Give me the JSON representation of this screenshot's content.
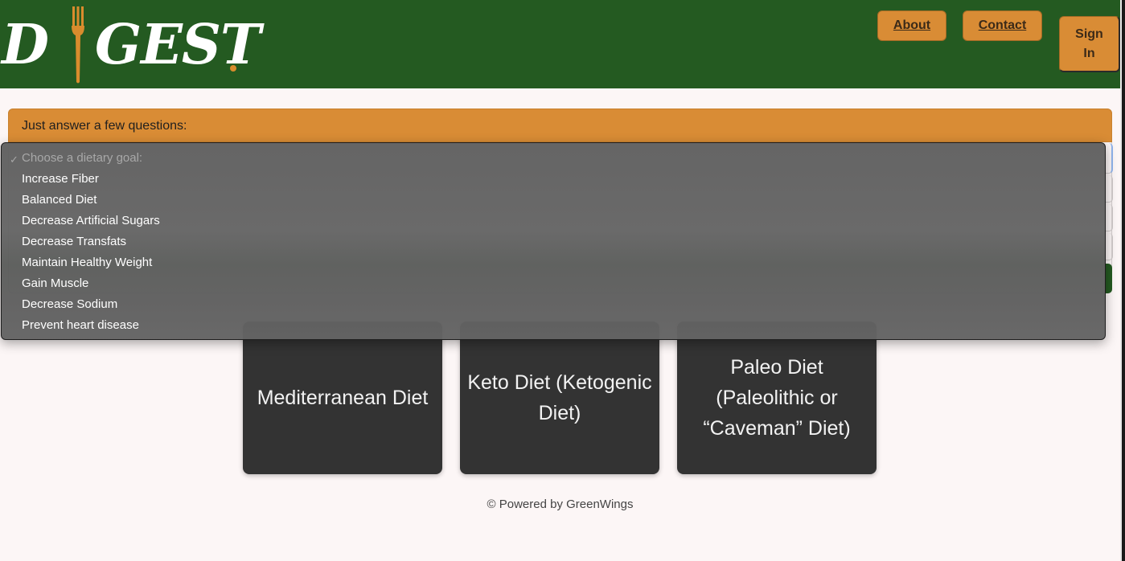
{
  "logo": {
    "letter_d": "D",
    "letters_gest": "GEST"
  },
  "nav": {
    "about": "About",
    "contact": "Contact",
    "sign_in_line1": "Sign",
    "sign_in_line2": "In"
  },
  "form": {
    "header": "Just answer a few questions:"
  },
  "dropdown": {
    "selected_mark": "✓",
    "placeholder": "Choose a dietary goal:",
    "options": [
      "Increase Fiber",
      "Balanced Diet",
      "Decrease Artificial Sugars",
      "Decrease Transfats",
      "Maintain Healthy Weight",
      "Gain Muscle",
      "Decrease Sodium",
      "Prevent heart disease"
    ]
  },
  "diets": [
    "Mediterranean Diet",
    "Keto Diet (Ketogenic Diet)",
    "Paleo Diet (Paleolithic or “Caveman” Diet)"
  ],
  "footer": "© Powered by GreenWings",
  "colors": {
    "header_bg": "#245a21",
    "accent": "#d98c35",
    "card_bg": "#333333",
    "page_bg": "#fcf6f6"
  }
}
